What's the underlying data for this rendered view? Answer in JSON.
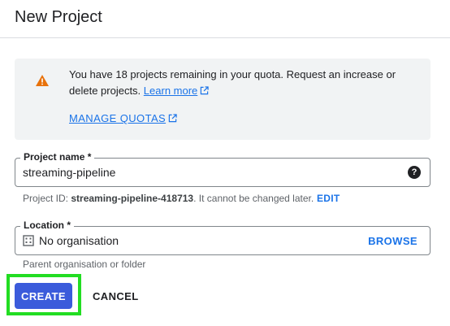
{
  "dialog": {
    "title": "New Project"
  },
  "alert": {
    "message": "You have 18 projects remaining in your quota. Request an increase or delete projects.",
    "learn_more": "Learn more",
    "manage_quotas": "MANAGE QUOTAS",
    "icon": "warning-icon",
    "icon_color": "#e8710a"
  },
  "project_name": {
    "label": "Project name *",
    "value": "streaming-pipeline",
    "icon": "help-icon"
  },
  "project_id": {
    "prefix": "Project ID:",
    "id": "streaming-pipeline-418713",
    "suffix": ". It cannot be changed later.",
    "edit": "EDIT"
  },
  "location": {
    "label": "Location *",
    "value": "No organisation",
    "icon": "organisation-icon",
    "browse": "BROWSE",
    "helper": "Parent organisation or folder"
  },
  "actions": {
    "create": "CREATE",
    "cancel": "CANCEL",
    "create_color": "#3b5bdb",
    "highlight_color": "#22dd22"
  },
  "colors": {
    "link": "#1a73e8",
    "alert_bg": "#f1f3f4"
  }
}
